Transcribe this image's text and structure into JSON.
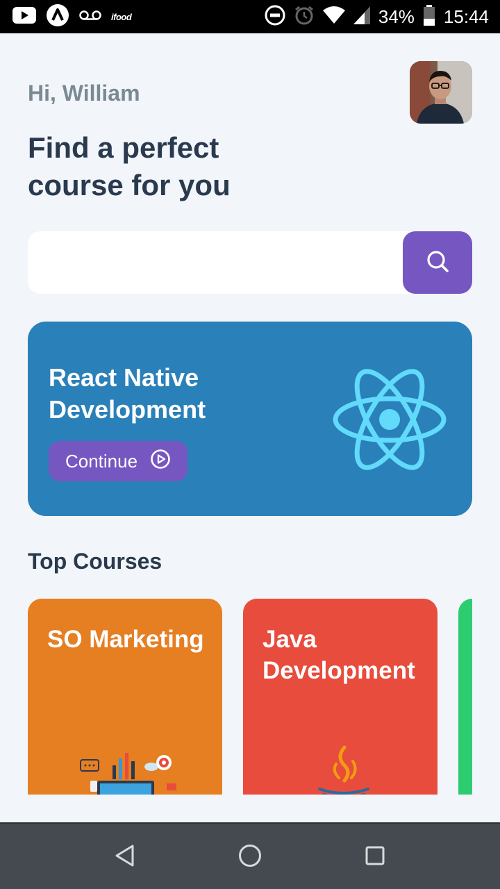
{
  "status_bar": {
    "app_icons": [
      "youtube-icon",
      "app-a-icon",
      "voicemail-icon"
    ],
    "ifood_label": "ifood",
    "battery_percent": "34%",
    "time": "15:44"
  },
  "header": {
    "greeting": "Hi, William",
    "headline": "Find a perfect course for you"
  },
  "search": {
    "value": "",
    "placeholder": ""
  },
  "featured": {
    "title": "React Native Development",
    "continue_label": "Continue",
    "background": "#2a80b9",
    "button_color": "#7657c1",
    "logo_color": "#61dafb"
  },
  "top_courses": {
    "title": "Top Courses",
    "items": [
      {
        "title": "SO Marketing",
        "color": "#e67e22",
        "icon": "seo-illustration"
      },
      {
        "title": "Java Development",
        "color": "#e74c3c",
        "icon": "java-logo"
      },
      {
        "title": "",
        "color": "#2ecc71",
        "icon": ""
      }
    ]
  },
  "colors": {
    "accent": "#7657c1",
    "heading": "#2a3a4e",
    "greeting": "#7a8a93",
    "page_bg": "#f2f5fa"
  }
}
